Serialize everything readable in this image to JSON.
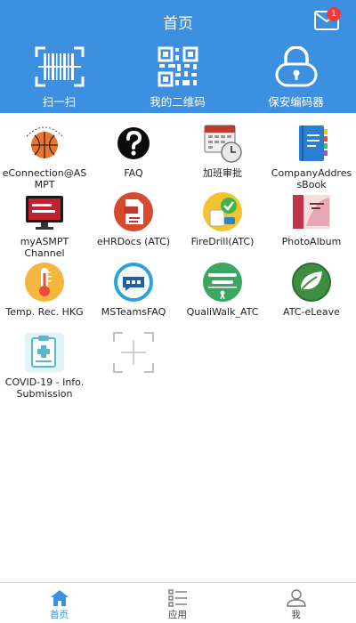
{
  "header": {
    "title": "首页",
    "mail_badge": "1",
    "background_color": "#3d8fe0",
    "quick_actions": [
      {
        "label": "扫一扫",
        "icon": "barcode-scan-icon"
      },
      {
        "label": "我的二维码",
        "icon": "qr-code-icon"
      },
      {
        "label": "保安编码器",
        "icon": "padlock-icon"
      }
    ]
  },
  "apps": [
    {
      "label": "eConnection@ASMPT",
      "icon": "basketball-icon"
    },
    {
      "label": "FAQ",
      "icon": "question-mark-icon"
    },
    {
      "label": "加班审批",
      "icon": "calendar-clock-icon"
    },
    {
      "label": "CompanyAddressBook",
      "icon": "address-book-icon"
    },
    {
      "label": "myASMPT Channel",
      "icon": "monitor-channel-icon"
    },
    {
      "label": "eHRDocs (ATC)",
      "icon": "pdf-document-icon"
    },
    {
      "label": "FireDrill(ATC)",
      "icon": "fire-drill-check-icon"
    },
    {
      "label": "PhotoAlbum",
      "icon": "photo-album-icon"
    },
    {
      "label": "Temp. Rec. HKG",
      "icon": "thermometer-icon"
    },
    {
      "label": "MSTeamsFAQ",
      "icon": "teams-faq-icon"
    },
    {
      "label": "QualiWalk_ATC",
      "icon": "health-walks-icon"
    },
    {
      "label": "ATC-eLeave",
      "icon": "leaf-icon"
    },
    {
      "label": "COVID-19 - Info. Submission",
      "icon": "medical-form-icon"
    }
  ],
  "tabbar": {
    "tabs": [
      {
        "label": "首页",
        "icon": "home-icon",
        "active": true
      },
      {
        "label": "应用",
        "icon": "app-list-icon",
        "active": false
      },
      {
        "label": "我",
        "icon": "person-icon",
        "active": false
      }
    ],
    "active_color": "#3d8fe0"
  }
}
